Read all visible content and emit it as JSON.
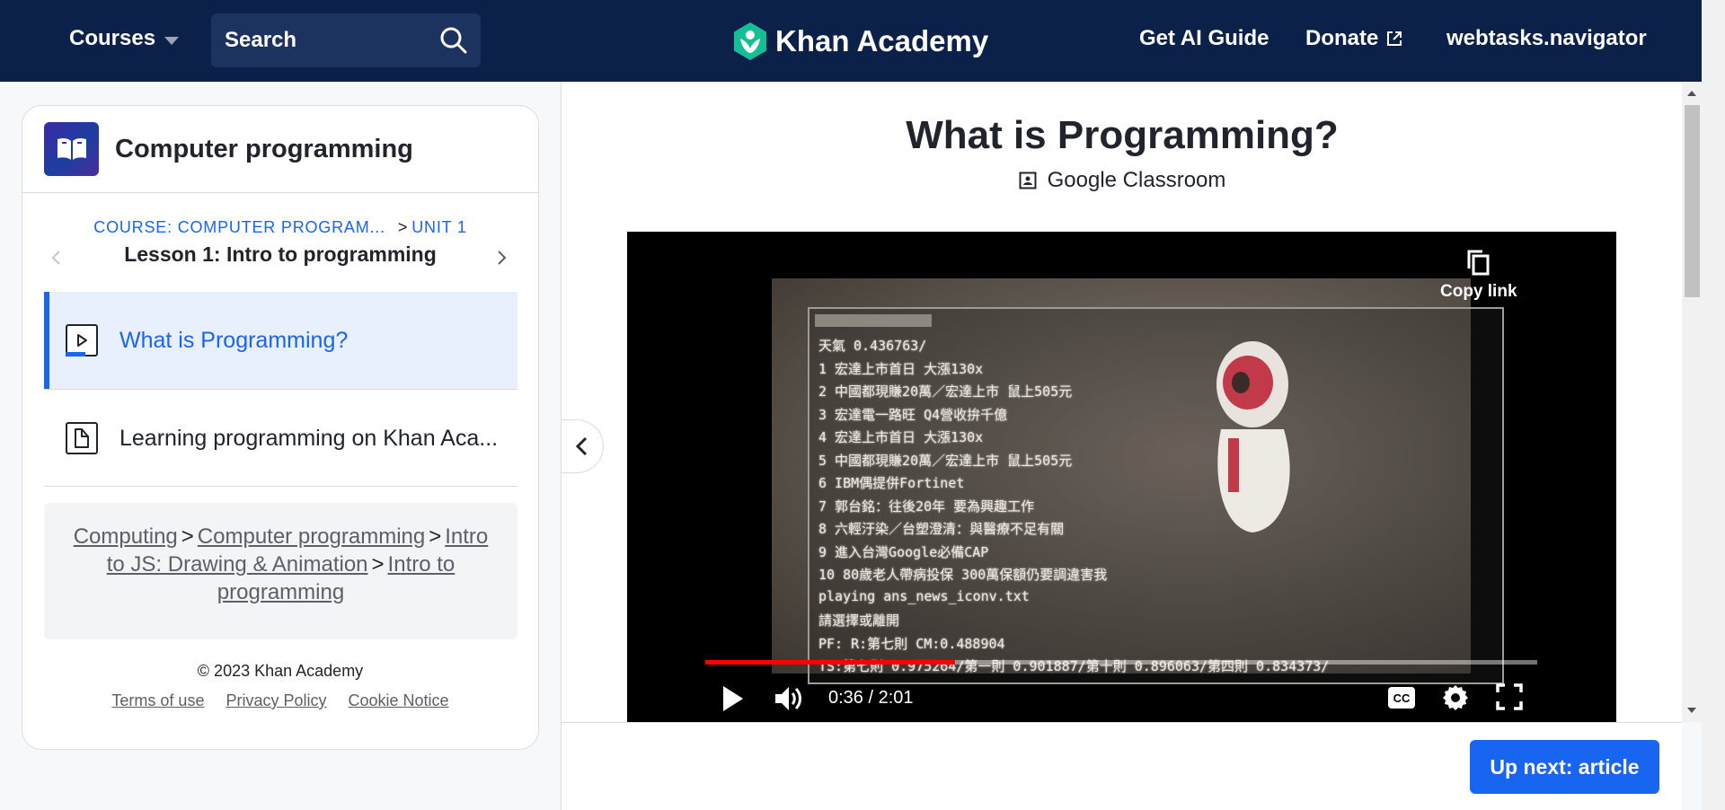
{
  "header": {
    "courses_label": "Courses",
    "search_placeholder": "Search",
    "brand_name": "Khan Academy",
    "ai_guide_label": "Get AI Guide",
    "donate_label": "Donate",
    "user_label": "webtasks.navigator"
  },
  "sidebar": {
    "course_title": "Computer programming",
    "breadcrumb_course": "COURSE: COMPUTER PROGRAM...",
    "breadcrumb_sep": ">",
    "breadcrumb_unit": "UNIT 1",
    "lesson_title": "Lesson 1: Intro to programming",
    "items": [
      {
        "label": "What is Programming?",
        "type": "video"
      },
      {
        "label": "Learning programming on Khan Aca...",
        "type": "article"
      }
    ],
    "path": [
      "Computing",
      "Computer programming",
      "Intro to JS: Drawing & Animation",
      "Intro to programming"
    ],
    "path_sep": ">",
    "copyright": "© 2023 Khan Academy",
    "footer_links": [
      "Terms of use",
      "Privacy Policy",
      "Cookie Notice"
    ]
  },
  "main": {
    "title": "What is Programming?",
    "classroom_label": "Google Classroom",
    "up_next_label": "Up next: article"
  },
  "video": {
    "copy_link_label": "Copy link",
    "time": "0:36 / 2:01",
    "progress": 0.3,
    "progress_color": "#ff0000",
    "terminal_lines": [
      "天氣 0.436763/",
      "1 宏達上市首日 大漲130x",
      "2 中國都現賺20萬／宏達上市  鼠上505元",
      "3 宏達電一路旺 Q4營收拚千億",
      "4 宏達上市首日 大漲130x",
      "5 中國都現賺20萬／宏達上市  鼠上505元",
      "6 IBM偶提併Fortinet",
      "7 郭台銘：往後20年 要為興趣工作",
      "8 六輕汙染／台塑澄清：與醫療不足有關",
      "9 進入台灣Google必備CAP",
      "10 80歲老人帶病投保  300萬保額仍要調違害我",
      "playing ans_news_iconv.txt",
      "請選擇或離開",
      "PF: R:第七則 CM:0.488904",
      "TS:第七則 0.975264/第一則 0.901887/第十則 0.896063/第四則 0.834373/"
    ]
  },
  "colors": {
    "header_bg": "#0b2149",
    "accent": "#1865f2",
    "active_item_bg": "#e8f0fe",
    "brand_leaf": "#14bf96"
  },
  "icons": [
    "chevron-down-icon",
    "search-icon",
    "khan-leaf-logo-icon",
    "external-link-icon",
    "book-icon",
    "chevron-left-icon",
    "chevron-right-icon",
    "video-icon",
    "article-icon",
    "google-classroom-icon",
    "copy-icon",
    "play-icon",
    "volume-icon",
    "cc-icon",
    "settings-icon",
    "fullscreen-icon"
  ]
}
